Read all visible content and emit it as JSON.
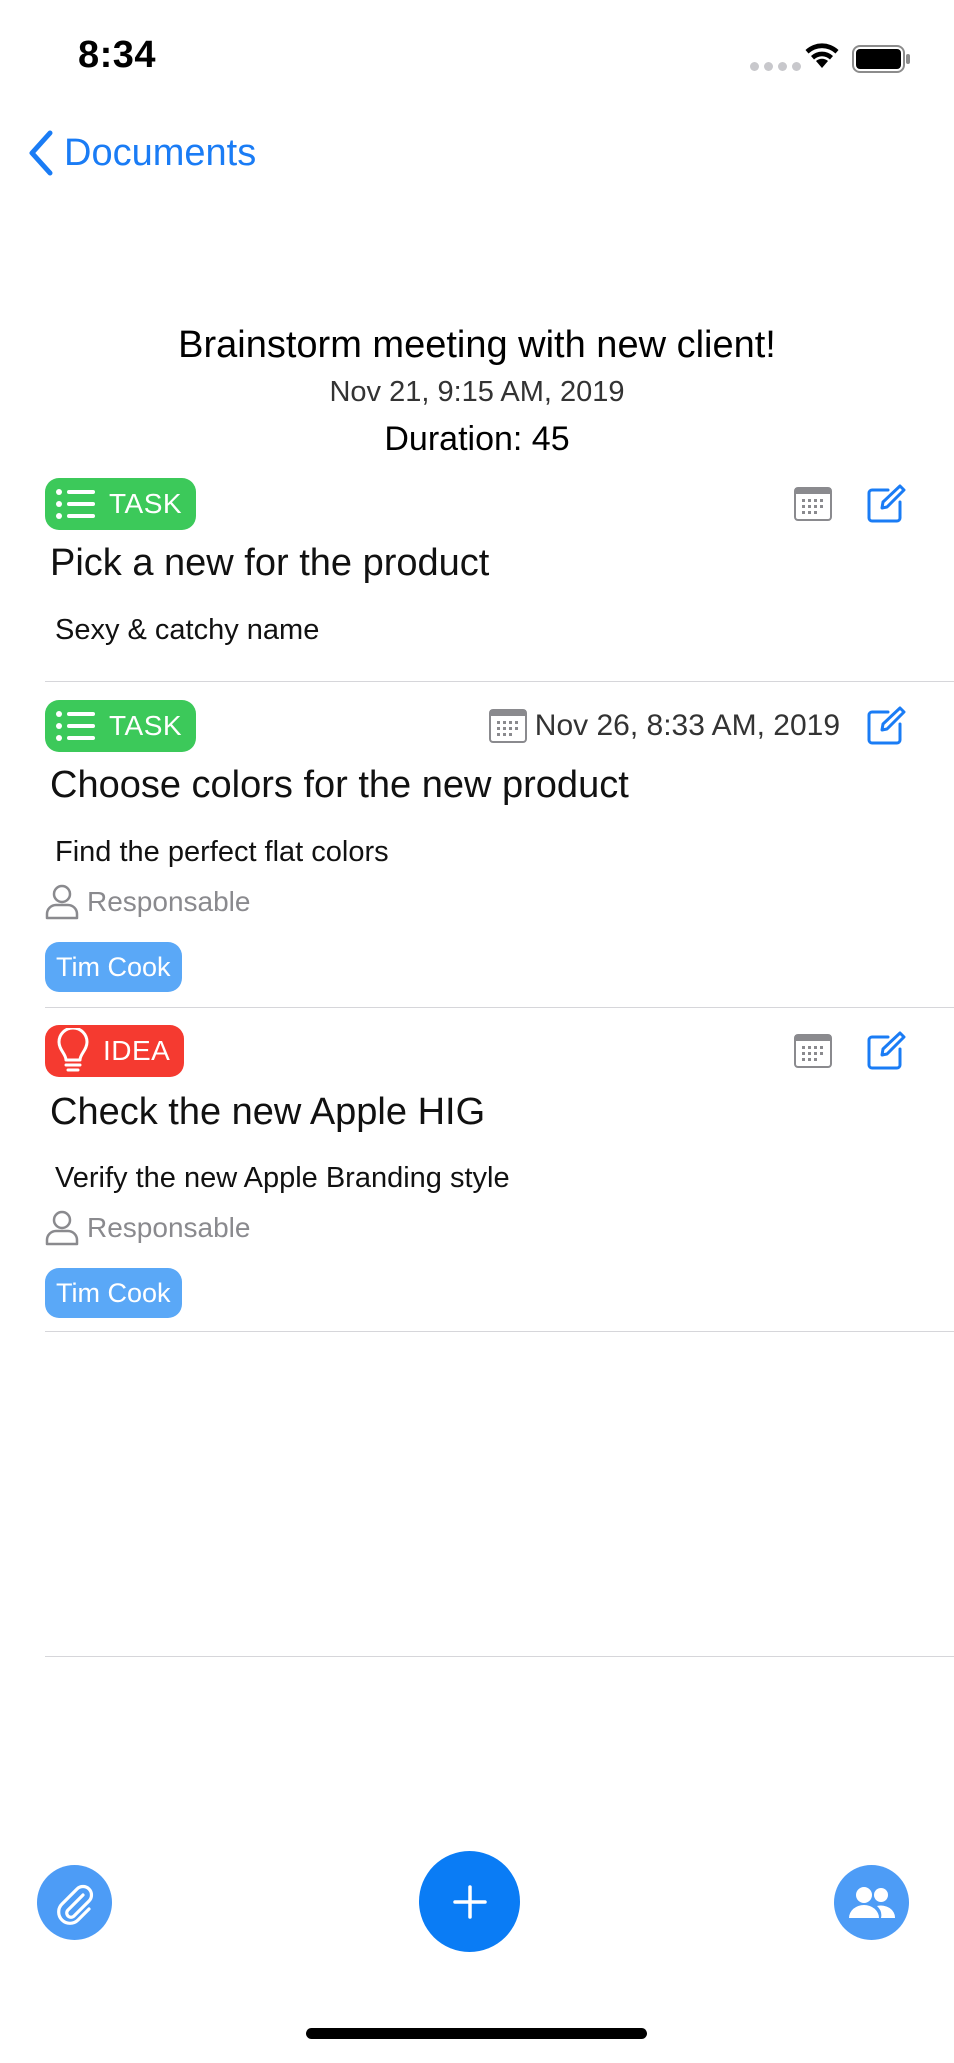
{
  "status_bar": {
    "time": "8:34"
  },
  "nav": {
    "back_label": "Documents"
  },
  "header": {
    "title": "Brainstorm meeting with new client!",
    "date": "Nov 21, 9:15 AM, 2019",
    "duration": "Duration: 45"
  },
  "colors": {
    "accent": "#0a7cf5",
    "task_badge": "#3cc95a",
    "idea_badge": "#f53a30",
    "assignee_chip": "#5aa8f7"
  },
  "items": [
    {
      "type_label": "TASK",
      "type_icon": "list-icon",
      "date": "",
      "title": "Pick a new for the product",
      "description": "Sexy & catchy name"
    },
    {
      "type_label": "TASK",
      "type_icon": "list-icon",
      "date": "Nov 26, 8:33 AM, 2019",
      "title": "Choose colors for the new product",
      "description": "Find the perfect flat colors",
      "responsable_label": "Responsable",
      "assignee": "Tim Cook"
    },
    {
      "type_label": "IDEA",
      "type_icon": "lightbulb-icon",
      "date": "",
      "title": "Check the new Apple HIG",
      "description": "Verify the new Apple Branding style",
      "responsable_label": "Responsable",
      "assignee": "Tim Cook"
    }
  ],
  "toolbar": {
    "attach_icon": "paperclip-icon",
    "add_icon": "plus-icon",
    "people_icon": "people-icon"
  }
}
